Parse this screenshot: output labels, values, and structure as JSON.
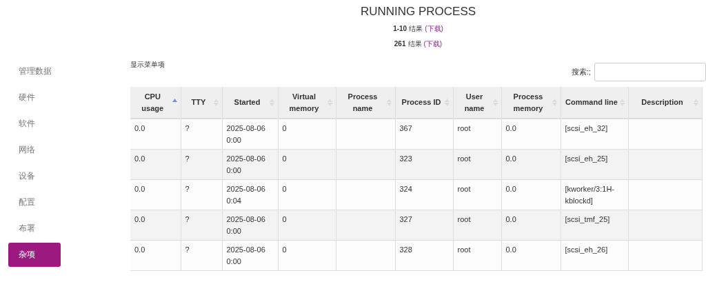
{
  "sidebar": {
    "items": [
      {
        "label": "管理数据",
        "selected": false
      },
      {
        "label": "硬件",
        "selected": false
      },
      {
        "label": "软件",
        "selected": false
      },
      {
        "label": "网络",
        "selected": false
      },
      {
        "label": "设备",
        "selected": false
      },
      {
        "label": "配置",
        "selected": false
      },
      {
        "label": "布署",
        "selected": false
      },
      {
        "label": "杂项",
        "selected": true
      }
    ]
  },
  "title": "RUNNING PROCESS",
  "summaries": [
    {
      "count": "1-10",
      "label": "结果",
      "link": "(下载)"
    },
    {
      "count": "261",
      "label": "结果",
      "link": "(下载)"
    }
  ],
  "column_toggle": "显示菜单项",
  "search": {
    "label": "搜索:;"
  },
  "table": {
    "columns": [
      {
        "label": "CPU usage",
        "sorted_ascending": true
      },
      {
        "label": "TTY",
        "sorted_ascending": false
      },
      {
        "label": "Started",
        "sorted_ascending": false
      },
      {
        "label": "Virtual memory",
        "sorted_ascending": false
      },
      {
        "label": "Process name",
        "sorted_ascending": false
      },
      {
        "label": "Process ID",
        "sorted_ascending": false
      },
      {
        "label": "User name",
        "sorted_ascending": false
      },
      {
        "label": "Process memory",
        "sorted_ascending": false
      },
      {
        "label": "Command line",
        "sorted_ascending": false
      },
      {
        "label": "Description",
        "sorted_ascending": false
      }
    ],
    "rows": [
      [
        "0.0",
        "?",
        "2025-08-06 0:00",
        "0",
        "",
        "367",
        "root",
        "0.0",
        "[scsi_eh_32]",
        ""
      ],
      [
        "0.0",
        "?",
        "2025-08-06 0:00",
        "0",
        "",
        "323",
        "root",
        "0.0",
        "[scsi_eh_25]",
        ""
      ],
      [
        "0.0",
        "?",
        "2025-08-06 0:04",
        "0",
        "",
        "324",
        "root",
        "0.0",
        "[kworker/3:1H-kblockd]",
        ""
      ],
      [
        "0.0",
        "?",
        "2025-08-06 0:00",
        "0",
        "",
        "327",
        "root",
        "0.0",
        "[scsi_tmf_25]",
        ""
      ],
      [
        "0.0",
        "?",
        "2025-08-06 0:00",
        "0",
        "",
        "328",
        "root",
        "0.0",
        "[scsi_eh_26]",
        ""
      ]
    ]
  }
}
